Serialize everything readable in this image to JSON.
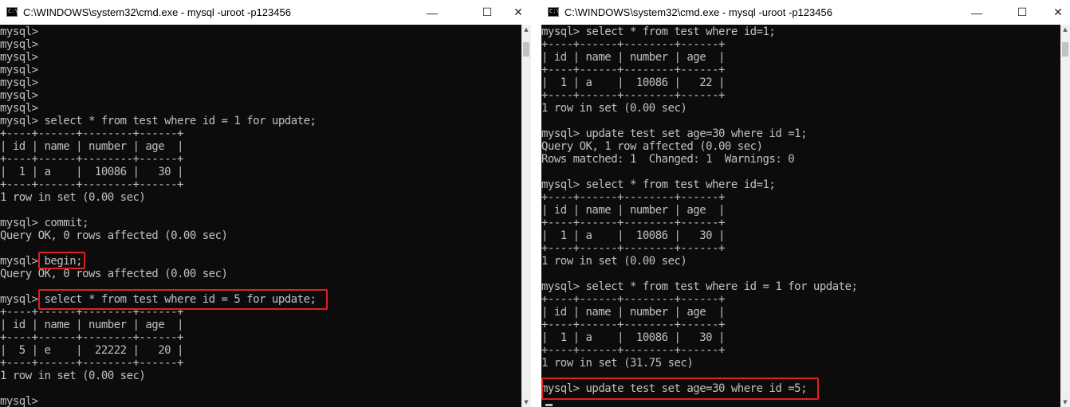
{
  "left_window": {
    "title": "C:\\WINDOWS\\system32\\cmd.exe - mysql  -uroot -p123456",
    "icon_label": "C:\\",
    "lines": [
      "mysql>",
      "mysql>",
      "mysql>",
      "mysql>",
      "mysql>",
      "mysql>",
      "mysql>",
      "mysql> select * from test where id = 1 for update;",
      "+----+------+--------+------+",
      "| id | name | number | age  |",
      "+----+------+--------+------+",
      "|  1 | a    |  10086 |   30 |",
      "+----+------+--------+------+",
      "1 row in set (0.00 sec)",
      "",
      "mysql> commit;",
      "Query OK, 0 rows affected (0.00 sec)",
      "",
      "mysql> begin;",
      "Query OK, 0 rows affected (0.00 sec)",
      "",
      "mysql> select * from test where id = 5 for update;",
      "+----+------+--------+------+",
      "| id | name | number | age  |",
      "+----+------+--------+------+",
      "|  5 | e    |  22222 |   20 |",
      "+----+------+--------+------+",
      "1 row in set (0.00 sec)",
      "",
      "mysql>"
    ]
  },
  "right_window": {
    "title": "C:\\WINDOWS\\system32\\cmd.exe - mysql  -uroot -p123456",
    "icon_label": "C:\\",
    "lines": [
      "mysql> select * from test where id=1;",
      "+----+------+--------+------+",
      "| id | name | number | age  |",
      "+----+------+--------+------+",
      "|  1 | a    |  10086 |   22 |",
      "+----+------+--------+------+",
      "1 row in set (0.00 sec)",
      "",
      "mysql> update test set age=30 where id =1;",
      "Query OK, 1 row affected (0.00 sec)",
      "Rows matched: 1  Changed: 1  Warnings: 0",
      "",
      "mysql> select * from test where id=1;",
      "+----+------+--------+------+",
      "| id | name | number | age  |",
      "+----+------+--------+------+",
      "|  1 | a    |  10086 |   30 |",
      "+----+------+--------+------+",
      "1 row in set (0.00 sec)",
      "",
      "mysql> select * from test where id = 1 for update;",
      "+----+------+--------+------+",
      "| id | name | number | age  |",
      "+----+------+--------+------+",
      "|  1 | a    |  10086 |   30 |",
      "+----+------+--------+------+",
      "1 row in set (31.75 sec)",
      "",
      "mysql> update test set age=30 where id =5;"
    ]
  },
  "window_controls": {
    "minimize": "—",
    "maximize": "☐",
    "close": "✕"
  },
  "colors": {
    "console_bg": "#0c0c0c",
    "console_text": "#c0c0c0",
    "highlight_box": "#e02020",
    "titlebar_bg": "#ffffff"
  }
}
